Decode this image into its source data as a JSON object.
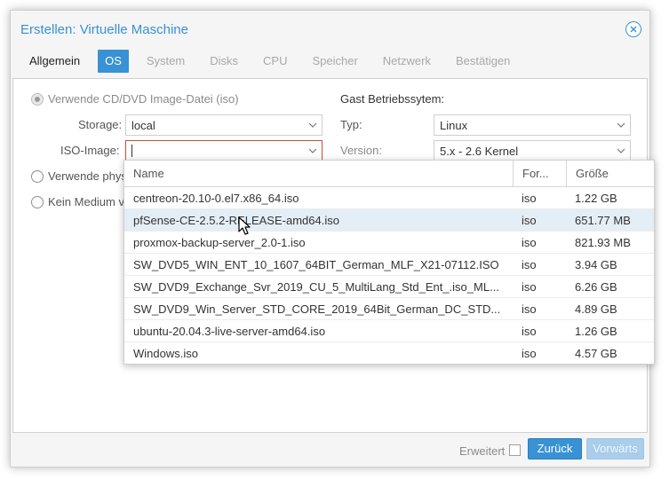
{
  "window": {
    "title": "Erstellen: Virtuelle Maschine"
  },
  "tabs": [
    {
      "label": "Allgemein"
    },
    {
      "label": "OS"
    },
    {
      "label": "System"
    },
    {
      "label": "Disks"
    },
    {
      "label": "CPU"
    },
    {
      "label": "Speicher"
    },
    {
      "label": "Netzwerk"
    },
    {
      "label": "Bestätigen"
    }
  ],
  "os_panel": {
    "radio_iso_label": "Verwende CD/DVD Image-Datei (iso)",
    "radio_phys_label": "Verwende phys",
    "radio_none_label": "Kein Medium v",
    "storage_label": "Storage:",
    "storage_value": "local",
    "iso_label": "ISO-Image:",
    "iso_value": "",
    "guest_os_heading": "Gast Betriebssytem:",
    "type_label": "Typ:",
    "type_value": "Linux",
    "version_label": "Version:",
    "version_value": "5.x - 2.6 Kernel"
  },
  "iso_list": {
    "columns": [
      "Name",
      "For...",
      "Größe"
    ],
    "rows": [
      {
        "name": "centreon-20.10-0.el7.x86_64.iso",
        "format": "iso",
        "size": "1.22 GB"
      },
      {
        "name": "pfSense-CE-2.5.2-RELEASE-amd64.iso",
        "format": "iso",
        "size": "651.77 MB"
      },
      {
        "name": "proxmox-backup-server_2.0-1.iso",
        "format": "iso",
        "size": "821.93 MB"
      },
      {
        "name": "SW_DVD5_WIN_ENT_10_1607_64BIT_German_MLF_X21-07112.ISO",
        "format": "iso",
        "size": "3.94 GB"
      },
      {
        "name": "SW_DVD9_Exchange_Svr_2019_CU_5_MultiLang_Std_Ent_.iso_ML...",
        "format": "iso",
        "size": "6.26 GB"
      },
      {
        "name": "SW_DVD9_Win_Server_STD_CORE_2019_64Bit_German_DC_STD...",
        "format": "iso",
        "size": "4.89 GB"
      },
      {
        "name": "ubuntu-20.04.3-live-server-amd64.iso",
        "format": "iso",
        "size": "1.26 GB"
      },
      {
        "name": "Windows.iso",
        "format": "iso",
        "size": "4.57 GB"
      }
    ]
  },
  "footer": {
    "advanced_label": "Erweitert",
    "back_label": "Zurück",
    "next_label": "Vorwärts"
  },
  "colors": {
    "accent": "#3892d4",
    "invalid_border": "#cf4c35",
    "hover_row": "#e4eef7"
  },
  "icons": {
    "close": "close-circle-icon",
    "combo_caret": "chevron-down-icon",
    "pointer": "mouse-cursor-icon"
  }
}
